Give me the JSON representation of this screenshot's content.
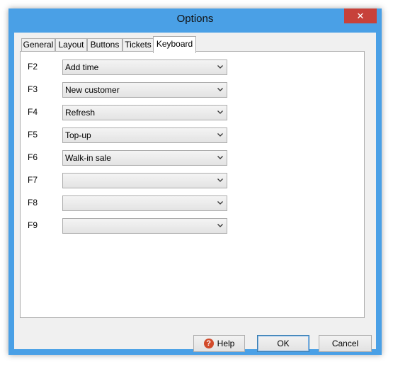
{
  "window": {
    "title": "Options",
    "close_glyph": "✕"
  },
  "tabs": [
    {
      "label": "General"
    },
    {
      "label": "Layout"
    },
    {
      "label": "Buttons"
    },
    {
      "label": "Tickets"
    },
    {
      "label": "Keyboard",
      "active": true
    }
  ],
  "shortcuts": [
    {
      "key": "F2",
      "value": "Add time"
    },
    {
      "key": "F3",
      "value": "New customer"
    },
    {
      "key": "F4",
      "value": "Refresh"
    },
    {
      "key": "F5",
      "value": "Top-up"
    },
    {
      "key": "F6",
      "value": "Walk-in sale"
    },
    {
      "key": "F7",
      "value": ""
    },
    {
      "key": "F8",
      "value": ""
    },
    {
      "key": "F9",
      "value": ""
    }
  ],
  "buttons": {
    "help": "Help",
    "help_icon": "?",
    "ok": "OK",
    "cancel": "Cancel"
  },
  "colors": {
    "titlebar": "#4aa0e6",
    "close": "#c7413a",
    "help_icon": "#d24a2a"
  }
}
